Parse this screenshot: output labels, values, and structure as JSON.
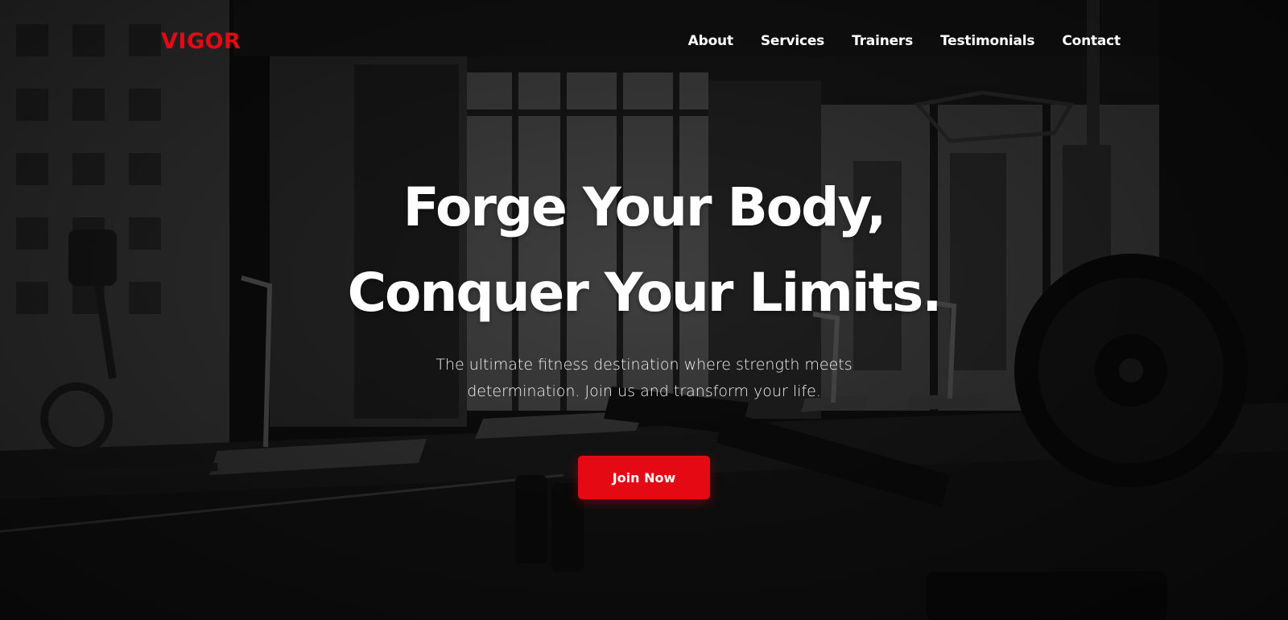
{
  "brand": {
    "logo_text": "VIGOR",
    "accent_color": "#e50914"
  },
  "nav": {
    "items": [
      {
        "label": "About"
      },
      {
        "label": "Services"
      },
      {
        "label": "Trainers"
      },
      {
        "label": "Testimonials"
      },
      {
        "label": "Contact"
      }
    ]
  },
  "hero": {
    "title_line1": "Forge Your Body,",
    "title_line2": "Conquer Your Limits.",
    "subtitle": "The ultimate fitness destination where strength meets determination. Join us and transform your life.",
    "cta_label": "Join Now",
    "background_icon": "gym-interior-photo"
  }
}
